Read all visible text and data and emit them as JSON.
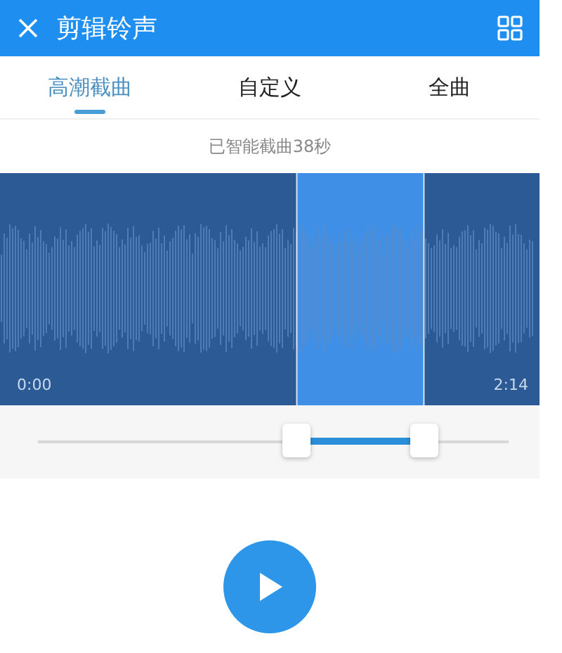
{
  "header": {
    "title": "剪辑铃声"
  },
  "tabs": [
    {
      "label": "高潮截曲",
      "selected": true
    },
    {
      "label": "自定义",
      "selected": false
    },
    {
      "label": "全曲",
      "selected": false
    }
  ],
  "hint": "已智能截曲38秒",
  "waveform": {
    "start_time": "0:00",
    "end_time": "2:14"
  },
  "range": {
    "handles": [
      {
        "level": 0.55
      },
      {
        "level": 0.82
      }
    ]
  },
  "player": {
    "playing": false
  }
}
